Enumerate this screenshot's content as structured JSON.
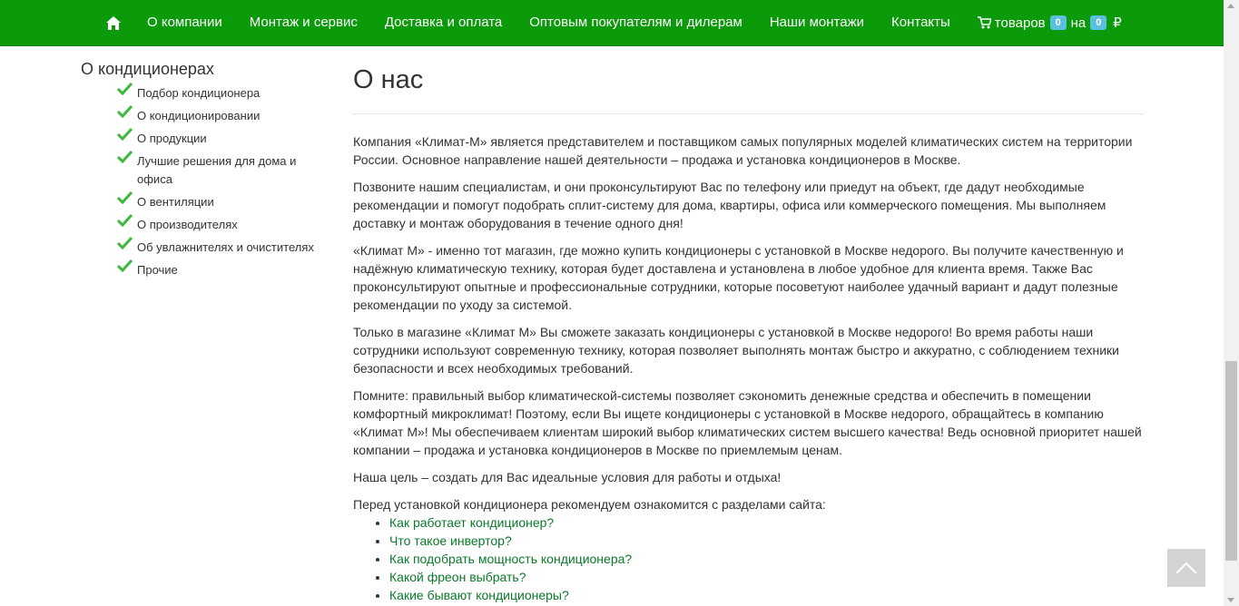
{
  "nav": {
    "home_icon": "home-icon",
    "items": [
      {
        "label": "О компании"
      },
      {
        "label": "Монтаж и сервис"
      },
      {
        "label": "Доставка и оплата"
      },
      {
        "label": "Оптовым покупателям и дилерам"
      },
      {
        "label": "Наши монтажи"
      },
      {
        "label": "Контакты"
      }
    ],
    "cart": {
      "icon": "cart-icon",
      "goods_label": "товаров",
      "goods_count": "0",
      "on_label": "на",
      "sum": "0",
      "currency": "₽"
    }
  },
  "sidebar": {
    "title": "О кондиционерах",
    "items": [
      {
        "label": "Подбор кондиционера"
      },
      {
        "label": "О кондиционировании"
      },
      {
        "label": "О продукции"
      },
      {
        "label": "Лучшие решения для дома и офиса"
      },
      {
        "label": "О вентиляции"
      },
      {
        "label": "О производителях"
      },
      {
        "label": "Об увлажнителях и очистителях"
      },
      {
        "label": "Прочие"
      }
    ]
  },
  "main": {
    "title": "О нас",
    "paragraphs": [
      "Компания «Климат-М» является представителем и поставщиком самых популярных моделей климатических систем на территории России. Основное направление нашей деятельности – продажа и установка кондиционеров в Москве.",
      "Позвоните нашим специалистам, и они проконсультируют Вас по телефону или приедут на объект, где дадут необходимые рекомендации и помогут подобрать сплит-систему для дома, квартиры, офиса или коммерческого помещения. Мы выполняем доставку и монтаж оборудования в течение одного дня!",
      "«Климат М» - именно тот магазин, где можно купить кондиционеры с установкой в Москве недорого. Вы получите качественную и надёжную климатическую технику, которая будет доставлена и установлена в любое удобное для клиента время. Также Вас проконсультируют опытные и профессиональные сотрудники, которые посоветуют наиболее удачный вариант и дадут полезные рекомендации по уходу за системой.",
      "Только в магазине «Климат М» Вы сможете заказать кондиционеры с установкой в Москве недорого! Во время работы наши сотрудники используют современную технику, которая позволяет выполнять монтаж быстро и аккуратно, с соблюдением техники безопасности и всех необходимых требований.",
      "Помните: правильный выбор климатической-системы позволяет сэкономить денежные средства и обеспечить в помещении комфортный микроклимат! Поэтому, если Вы ищете кондиционеры с установкой в Москве недорого, обращайтесь в компанию «Климат М»! Мы обеспечиваем клиентам широкий выбор климатических систем высшего качества! Ведь основной приоритет нашей компании – продажа и установка кондиционеров в Москве по приемлемым ценам.",
      "Наша цель – создать для Вас идеальные условия для работы и отдыха!"
    ],
    "links_intro": "Перед установкой кондиционера рекомендуем ознакомится с разделами сайта:",
    "links": [
      {
        "label": "Как работает кондиционер?"
      },
      {
        "label": "Что такое инвертор?"
      },
      {
        "label": "Как подобрать мощность кондиционера?"
      },
      {
        "label": "Какой фреон выбрать?"
      },
      {
        "label": "Какие бывают кондиционеры?"
      }
    ]
  },
  "colors": {
    "navbar": "#0a9a0a",
    "link": "#0a7a2a",
    "check": "#3db83d",
    "badge": "#5bc0de"
  },
  "scroll_to_top_icon": "chevron-up-icon"
}
